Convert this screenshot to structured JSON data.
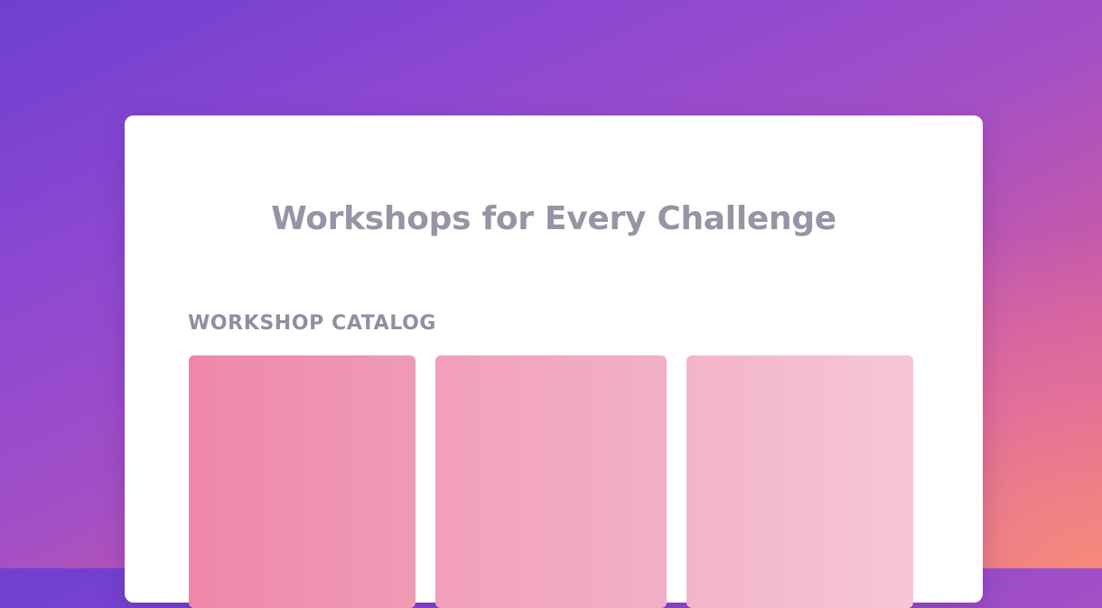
{
  "page": {
    "title": "Workshops for Every Challenge",
    "catalog_label": "WORKSHOP CATALOG"
  },
  "workshops": {
    "count_visible": 3
  },
  "colors": {
    "background_start": "#6e3fd0",
    "background_end": "#f38a7c",
    "card": "#ffffff",
    "title_text": "#9496a5",
    "label_text": "#8e90a1",
    "tile_1": "#ef87a8",
    "tile_2": "#f29fba",
    "tile_3": "#f3b4ca"
  }
}
